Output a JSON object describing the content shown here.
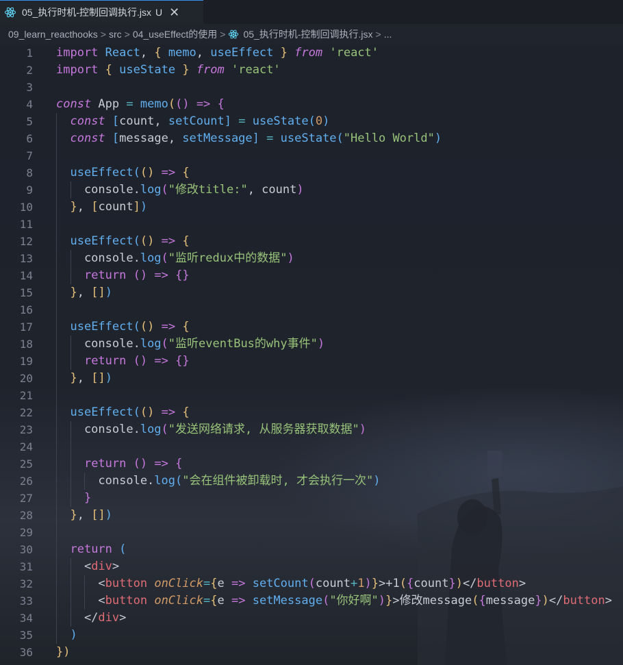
{
  "tab": {
    "title": "05_执行时机-控制回调执行.jsx",
    "status": "U",
    "close": "✕",
    "icon": "react-icon"
  },
  "breadcrumb": {
    "items": [
      "09_learn_reacthooks",
      "src",
      "04_useEffect的使用",
      "05_执行时机-控制回调执行.jsx",
      "..."
    ],
    "separator": ">"
  },
  "editor": {
    "line_numbers": [
      "1",
      "2",
      "3",
      "4",
      "5",
      "6",
      "7",
      "8",
      "9",
      "10",
      "11",
      "12",
      "13",
      "14",
      "15",
      "16",
      "17",
      "18",
      "19",
      "20",
      "21",
      "22",
      "23",
      "24",
      "25",
      "26",
      "27",
      "28",
      "29",
      "30",
      "31",
      "32",
      "33",
      "34",
      "35",
      "36"
    ],
    "lines": [
      [
        [
          "kw",
          "import"
        ],
        [
          "var",
          " "
        ],
        [
          "react",
          "React"
        ],
        [
          "var",
          ", "
        ],
        [
          "p1",
          "{"
        ],
        [
          "var",
          " "
        ],
        [
          "fn",
          "memo"
        ],
        [
          "var",
          ", "
        ],
        [
          "fn",
          "useEffect"
        ],
        [
          "var",
          " "
        ],
        [
          "p1",
          "}"
        ],
        [
          "var",
          " "
        ],
        [
          "kwi",
          "from"
        ],
        [
          "var",
          " "
        ],
        [
          "str",
          "'react'"
        ]
      ],
      [
        [
          "kw",
          "import"
        ],
        [
          "var",
          " "
        ],
        [
          "p1",
          "{"
        ],
        [
          "var",
          " "
        ],
        [
          "fn",
          "useState"
        ],
        [
          "var",
          " "
        ],
        [
          "p1",
          "}"
        ],
        [
          "var",
          " "
        ],
        [
          "kwi",
          "from"
        ],
        [
          "var",
          " "
        ],
        [
          "str",
          "'react'"
        ]
      ],
      [],
      [
        [
          "kwi",
          "const"
        ],
        [
          "var",
          " App "
        ],
        [
          "op",
          "="
        ],
        [
          "var",
          " "
        ],
        [
          "fn",
          "memo"
        ],
        [
          "p1",
          "("
        ],
        [
          "p2",
          "()"
        ],
        [
          "var",
          " "
        ],
        [
          "kw",
          "=>"
        ],
        [
          "var",
          " "
        ],
        [
          "p2",
          "{"
        ]
      ],
      [
        [
          "var",
          "  "
        ],
        [
          "kwi",
          "const"
        ],
        [
          "var",
          " "
        ],
        [
          "p3",
          "["
        ],
        [
          "var",
          "count, "
        ],
        [
          "fn",
          "setCount"
        ],
        [
          "p3",
          "]"
        ],
        [
          "var",
          " "
        ],
        [
          "op",
          "="
        ],
        [
          "var",
          " "
        ],
        [
          "fn",
          "useState"
        ],
        [
          "p3",
          "("
        ],
        [
          "num",
          "0"
        ],
        [
          "p3",
          ")"
        ]
      ],
      [
        [
          "var",
          "  "
        ],
        [
          "kwi",
          "const"
        ],
        [
          "var",
          " "
        ],
        [
          "p3",
          "["
        ],
        [
          "var",
          "message, "
        ],
        [
          "fn",
          "setMessage"
        ],
        [
          "p3",
          "]"
        ],
        [
          "var",
          " "
        ],
        [
          "op",
          "="
        ],
        [
          "var",
          " "
        ],
        [
          "fn",
          "useState"
        ],
        [
          "p3",
          "("
        ],
        [
          "str",
          "\"Hello World\""
        ],
        [
          "p3",
          ")"
        ]
      ],
      [],
      [
        [
          "var",
          "  "
        ],
        [
          "fn",
          "useEffect"
        ],
        [
          "p3",
          "("
        ],
        [
          "p1",
          "()"
        ],
        [
          "var",
          " "
        ],
        [
          "kw",
          "=>"
        ],
        [
          "var",
          " "
        ],
        [
          "p1",
          "{"
        ]
      ],
      [
        [
          "var",
          "    console."
        ],
        [
          "fn",
          "log"
        ],
        [
          "p2",
          "("
        ],
        [
          "str",
          "\"修改title:\""
        ],
        [
          "var",
          ", count"
        ],
        [
          "p2",
          ")"
        ]
      ],
      [
        [
          "var",
          "  "
        ],
        [
          "p1",
          "}"
        ],
        [
          "var",
          ", "
        ],
        [
          "p1",
          "["
        ],
        [
          "var",
          "count"
        ],
        [
          "p1",
          "]"
        ],
        [
          "p3",
          ")"
        ]
      ],
      [],
      [
        [
          "var",
          "  "
        ],
        [
          "fn",
          "useEffect"
        ],
        [
          "p3",
          "("
        ],
        [
          "p1",
          "()"
        ],
        [
          "var",
          " "
        ],
        [
          "kw",
          "=>"
        ],
        [
          "var",
          " "
        ],
        [
          "p1",
          "{"
        ]
      ],
      [
        [
          "var",
          "    console."
        ],
        [
          "fn",
          "log"
        ],
        [
          "p2",
          "("
        ],
        [
          "str",
          "\"监听redux中的数据\""
        ],
        [
          "p2",
          ")"
        ]
      ],
      [
        [
          "var",
          "    "
        ],
        [
          "kw",
          "return"
        ],
        [
          "var",
          " "
        ],
        [
          "p2",
          "()"
        ],
        [
          "var",
          " "
        ],
        [
          "kw",
          "=>"
        ],
        [
          "var",
          " "
        ],
        [
          "p2",
          "{}"
        ]
      ],
      [
        [
          "var",
          "  "
        ],
        [
          "p1",
          "}"
        ],
        [
          "var",
          ", "
        ],
        [
          "p1",
          "[]"
        ],
        [
          "p3",
          ")"
        ]
      ],
      [],
      [
        [
          "var",
          "  "
        ],
        [
          "fn",
          "useEffect"
        ],
        [
          "p3",
          "("
        ],
        [
          "p1",
          "()"
        ],
        [
          "var",
          " "
        ],
        [
          "kw",
          "=>"
        ],
        [
          "var",
          " "
        ],
        [
          "p1",
          "{"
        ]
      ],
      [
        [
          "var",
          "    console."
        ],
        [
          "fn",
          "log"
        ],
        [
          "p2",
          "("
        ],
        [
          "str",
          "\"监听eventBus的why事件\""
        ],
        [
          "p2",
          ")"
        ]
      ],
      [
        [
          "var",
          "    "
        ],
        [
          "kw",
          "return"
        ],
        [
          "var",
          " "
        ],
        [
          "p2",
          "()"
        ],
        [
          "var",
          " "
        ],
        [
          "kw",
          "=>"
        ],
        [
          "var",
          " "
        ],
        [
          "p2",
          "{}"
        ]
      ],
      [
        [
          "var",
          "  "
        ],
        [
          "p1",
          "}"
        ],
        [
          "var",
          ", "
        ],
        [
          "p1",
          "[]"
        ],
        [
          "p3",
          ")"
        ]
      ],
      [],
      [
        [
          "var",
          "  "
        ],
        [
          "fn",
          "useEffect"
        ],
        [
          "p3",
          "("
        ],
        [
          "p1",
          "()"
        ],
        [
          "var",
          " "
        ],
        [
          "kw",
          "=>"
        ],
        [
          "var",
          " "
        ],
        [
          "p1",
          "{"
        ]
      ],
      [
        [
          "var",
          "    console."
        ],
        [
          "fn",
          "log"
        ],
        [
          "p2",
          "("
        ],
        [
          "str",
          "\"发送网络请求, 从服务器获取数据\""
        ],
        [
          "p2",
          ")"
        ]
      ],
      [],
      [
        [
          "var",
          "    "
        ],
        [
          "kw",
          "return"
        ],
        [
          "var",
          " "
        ],
        [
          "p2",
          "()"
        ],
        [
          "var",
          " "
        ],
        [
          "kw",
          "=>"
        ],
        [
          "var",
          " "
        ],
        [
          "p2",
          "{"
        ]
      ],
      [
        [
          "var",
          "      console."
        ],
        [
          "fn",
          "log"
        ],
        [
          "p3",
          "("
        ],
        [
          "str",
          "\"会在组件被卸载时, 才会执行一次\""
        ],
        [
          "p3",
          ")"
        ]
      ],
      [
        [
          "var",
          "    "
        ],
        [
          "p2",
          "}"
        ]
      ],
      [
        [
          "var",
          "  "
        ],
        [
          "p1",
          "}"
        ],
        [
          "var",
          ", "
        ],
        [
          "p1",
          "[]"
        ],
        [
          "p3",
          ")"
        ]
      ],
      [],
      [
        [
          "var",
          "  "
        ],
        [
          "kw",
          "return"
        ],
        [
          "var",
          " "
        ],
        [
          "p3",
          "("
        ]
      ],
      [
        [
          "var",
          "    <"
        ],
        [
          "tag",
          "div"
        ],
        [
          "var",
          ">"
        ]
      ],
      [
        [
          "var",
          "      <"
        ],
        [
          "tag",
          "button"
        ],
        [
          "var",
          " "
        ],
        [
          "attr",
          "onClick"
        ],
        [
          "op",
          "="
        ],
        [
          "p1",
          "{"
        ],
        [
          "var",
          "e "
        ],
        [
          "kw",
          "=>"
        ],
        [
          "var",
          " "
        ],
        [
          "fn",
          "setCount"
        ],
        [
          "p2",
          "("
        ],
        [
          "var",
          "count"
        ],
        [
          "op",
          "+"
        ],
        [
          "num",
          "1"
        ],
        [
          "p2",
          ")"
        ],
        [
          "p1",
          "}"
        ],
        [
          "var",
          ">+1"
        ],
        [
          "p1",
          "("
        ],
        [
          "p2",
          "{"
        ],
        [
          "var",
          "count"
        ],
        [
          "p2",
          "}"
        ],
        [
          "p1",
          ")"
        ],
        [
          "var",
          "</"
        ],
        [
          "tag",
          "button"
        ],
        [
          "var",
          ">"
        ]
      ],
      [
        [
          "var",
          "      <"
        ],
        [
          "tag",
          "button"
        ],
        [
          "var",
          " "
        ],
        [
          "attr",
          "onClick"
        ],
        [
          "op",
          "="
        ],
        [
          "p1",
          "{"
        ],
        [
          "var",
          "e "
        ],
        [
          "kw",
          "=>"
        ],
        [
          "var",
          " "
        ],
        [
          "fn",
          "setMessage"
        ],
        [
          "p2",
          "("
        ],
        [
          "str",
          "\"你好啊\""
        ],
        [
          "p2",
          ")"
        ],
        [
          "p1",
          "}"
        ],
        [
          "var",
          ">修改message"
        ],
        [
          "p1",
          "("
        ],
        [
          "p2",
          "{"
        ],
        [
          "var",
          "message"
        ],
        [
          "p2",
          "}"
        ],
        [
          "p1",
          ")"
        ],
        [
          "var",
          "</"
        ],
        [
          "tag",
          "button"
        ],
        [
          "var",
          ">"
        ]
      ],
      [
        [
          "var",
          "    </"
        ],
        [
          "tag",
          "div"
        ],
        [
          "var",
          ">"
        ]
      ],
      [
        [
          "var",
          "  "
        ],
        [
          "p3",
          ")"
        ]
      ],
      [
        [
          "p1",
          "}"
        ],
        [
          "p1",
          ")"
        ]
      ]
    ]
  },
  "colors": {
    "keyword": "#c678dd",
    "function": "#61afef",
    "string": "#98c379",
    "number": "#d19a66",
    "tag": "#e06c75",
    "text": "#c8ccd4",
    "accent": "#3b8eea"
  }
}
